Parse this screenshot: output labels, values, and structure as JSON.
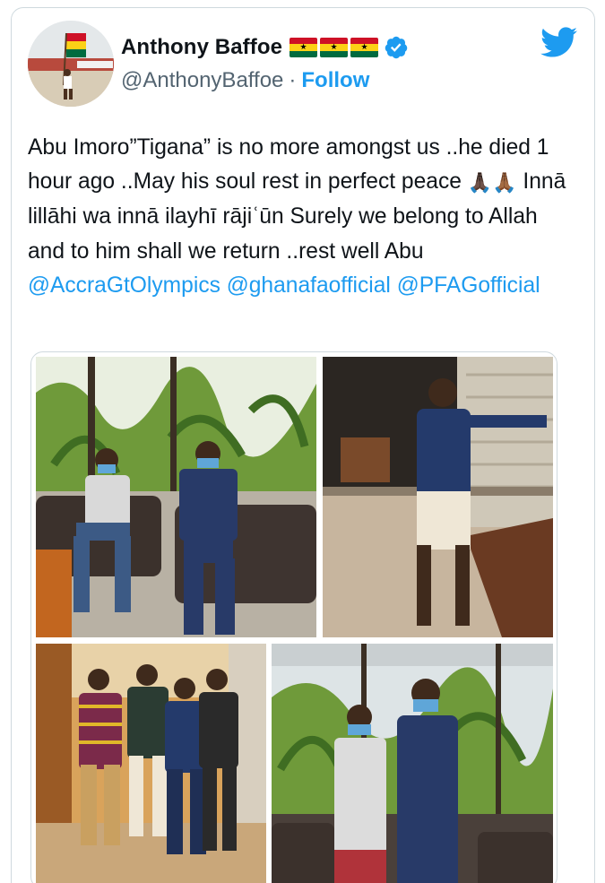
{
  "tweet": {
    "author": {
      "display_name": "Anthony Baffoe",
      "flags": [
        "ghana-flag",
        "ghana-flag",
        "ghana-flag"
      ],
      "verified": true,
      "handle": "@AnthonyBaffoe",
      "separator": "·",
      "follow_label": "Follow"
    },
    "brand_icon": "twitter-bird-icon",
    "text_segments": [
      {
        "text": "Abu Imoro”Tigana” is no more amongst us ..he died 1 hour ago ..May his soul rest in perfect peace ",
        "type": "text"
      },
      {
        "text": "🙏🏿🙏🏾",
        "type": "emoji"
      },
      {
        "text": " Innā lillāhi wa innā ilayhī rājiʿūn Surely we belong to Allah and to him shall we return ..rest well Abu ",
        "type": "text"
      },
      {
        "text": "@AccraGtOlympics",
        "type": "mention"
      },
      {
        "text": " ",
        "type": "text"
      },
      {
        "text": "@ghanafaofficial",
        "type": "mention"
      },
      {
        "text": " ",
        "type": "text"
      },
      {
        "text": "@PFAGofficial",
        "type": "mention"
      }
    ],
    "media": [
      {
        "name": "photo-two-men-seated"
      },
      {
        "name": "photo-man-standing"
      },
      {
        "name": "photo-group-of-four"
      },
      {
        "name": "photo-two-men-standing"
      }
    ]
  },
  "colors": {
    "accent": "#1d9bf0",
    "text": "#0f1419",
    "muted": "#536471",
    "border": "#cfd9de"
  }
}
